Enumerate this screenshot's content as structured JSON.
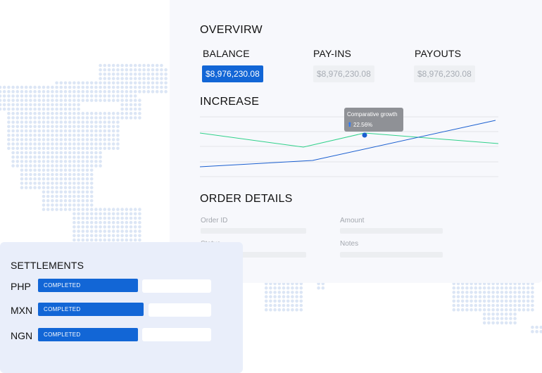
{
  "overview": {
    "title": "OVERVIRW",
    "metrics": [
      {
        "label": "BALANCE",
        "value": "$8,976,230.08",
        "active": true
      },
      {
        "label": "PAY-INS",
        "value": "$8,976,230.08",
        "active": false
      },
      {
        "label": "PAYOUTS",
        "value": "$8,976,230.08",
        "active": false
      }
    ]
  },
  "increase": {
    "title": "INCREASE",
    "tooltip": {
      "label": "Comparative growth",
      "icon": "arrow-up-icon",
      "value": "22.56%"
    },
    "colors": {
      "green": "#2fd18a",
      "blue": "#1a5fd0"
    }
  },
  "order_details": {
    "title": "ORDER DETAILS",
    "fields": [
      "Order ID",
      "Amount",
      "Status",
      "Notes"
    ]
  },
  "settlements": {
    "title": "SETTLEMENTS",
    "rows": [
      {
        "currency": "PHP",
        "status": "COMPLETED"
      },
      {
        "currency": "MXN",
        "status": "COMPLETED"
      },
      {
        "currency": "NGN",
        "status": "COMPLETED"
      }
    ]
  },
  "colors": {
    "accent": "#1266d6",
    "map_dot": "#dce6f5"
  }
}
